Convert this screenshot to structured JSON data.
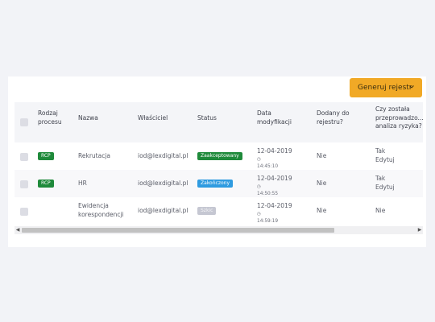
{
  "toolbar": {
    "generate_label": "Generuj rejestr"
  },
  "table": {
    "headers": {
      "type": [
        "Rodzaj",
        "procesu"
      ],
      "name": "Nazwa",
      "owner": "Właściciel",
      "status": "Status",
      "modified": [
        "Data",
        "modyfikacji"
      ],
      "added": [
        "Dodany do",
        "rejestru?"
      ],
      "analysis": [
        "Czy została",
        "przeprowadzo...",
        "analiza ryzyka?"
      ]
    },
    "rows": [
      {
        "type_badge": "RCP",
        "name": [
          "Rekrutacja"
        ],
        "owner": "iod@lexdigital.pl",
        "status": "Zaakceptowany",
        "status_color": "#1f8a3b",
        "date": "12-04-2019",
        "time": "14:45:10",
        "added": "Nie",
        "analysis": [
          "Tak",
          "Edytuj"
        ]
      },
      {
        "type_badge": "RCP",
        "name": [
          "HR"
        ],
        "owner": "iod@lexdigital.pl",
        "status": "Zakończony",
        "status_color": "#2f9be0",
        "date": "12-04-2019",
        "time": "14:50:55",
        "added": "Nie",
        "analysis": [
          "Tak",
          "Edytuj"
        ]
      },
      {
        "type_badge": "",
        "name": [
          "Ewidencja",
          "korespondencji"
        ],
        "owner": "iod@lexdigital.pl",
        "status": "Szkic",
        "status_color": "#c5c7d2",
        "date": "12-04-2019",
        "time": "14:59:19",
        "added": "Nie",
        "analysis": [
          "Nie"
        ]
      }
    ]
  },
  "icons": {
    "dropdown": "chevron-down-icon",
    "clock": "clock-icon",
    "scroll_left": "arrow-left-icon",
    "scroll_right": "arrow-right-icon"
  },
  "colors": {
    "accent": "#f1a926",
    "approved": "#1f8a3b",
    "finished": "#2f9be0",
    "draft": "#c5c7d2"
  }
}
